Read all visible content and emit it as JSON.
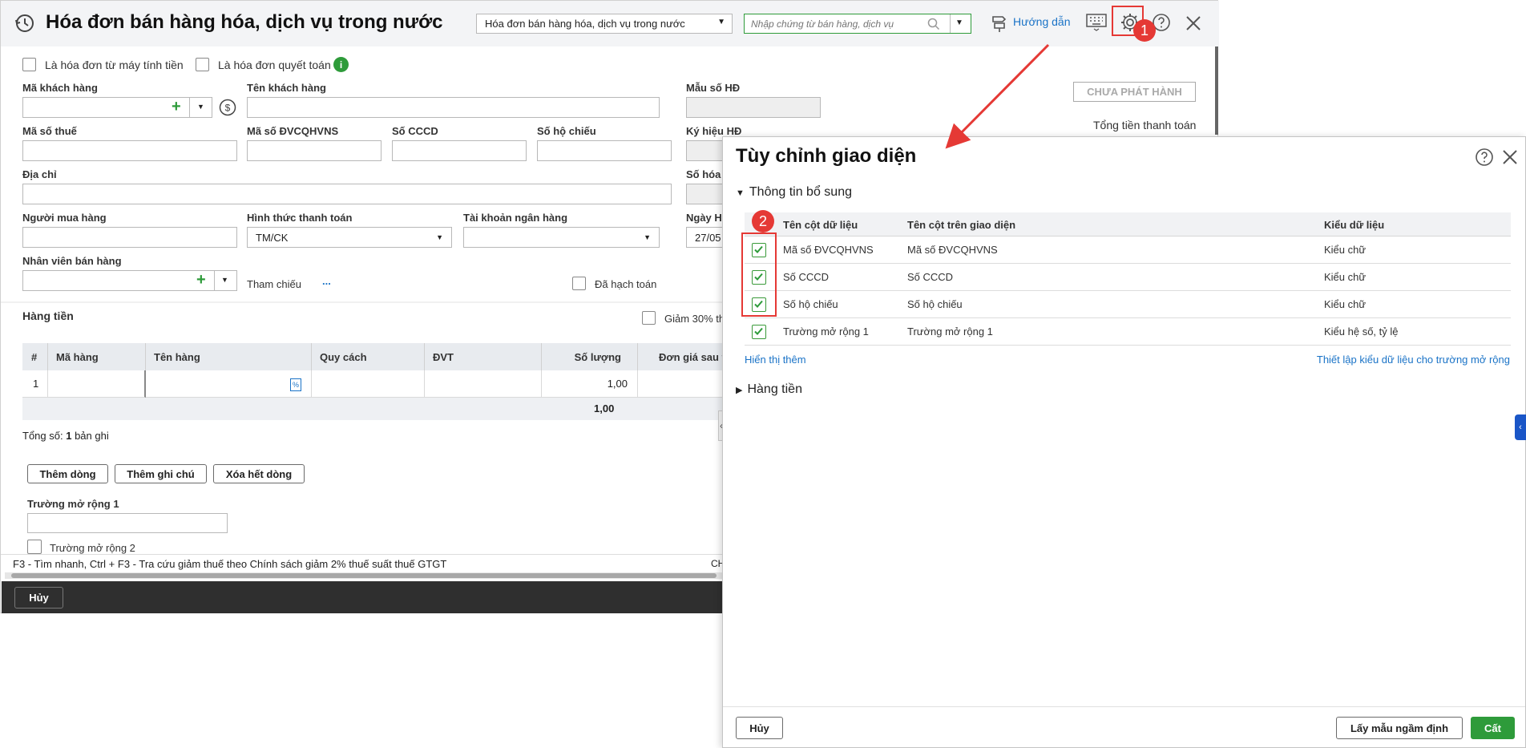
{
  "header": {
    "title": "Hóa đơn bán hàng hóa, dịch vụ trong nước",
    "type_select": "Hóa đơn bán hàng hóa, dịch vụ trong nước",
    "search_placeholder": "Nhập chứng từ bán hàng, dịch vụ",
    "guide": "Hướng dẫn"
  },
  "form": {
    "cb_cash_register": "Là hóa đơn từ máy tính tiền",
    "cb_settlement": "Là hóa đơn quyết toán",
    "customer_code": "Mã khách hàng",
    "customer_name": "Tên khách hàng",
    "tax_code": "Mã số thuế",
    "budget_unit_code": "Mã số ĐVCQHVNS",
    "citizen_id": "Số CCCD",
    "passport": "Số hộ chiếu",
    "address": "Địa chỉ",
    "buyer": "Người mua hàng",
    "payment_method": "Hình thức thanh toán",
    "payment_method_value": "TM/CK",
    "bank_account": "Tài khoản ngân hàng",
    "sales_staff": "Nhân viên bán hàng",
    "reference": "Tham chiếu",
    "reference_dots": "...",
    "posted": "Đã hạch toán",
    "invoice_form": "Mẫu số HĐ",
    "invoice_symbol": "Ký hiệu HĐ",
    "invoice_number_partial": "Số hóa đ",
    "date_partial": "Ngày H",
    "date_value_partial": "27/05",
    "status_button": "CHƯA PHÁT HÀNH",
    "total_payment": "Tổng tiền thanh toán"
  },
  "goods": {
    "section": "Hàng tiền",
    "discount_partial": "Giảm 30% th",
    "columns": [
      "#",
      "Mã hàng",
      "Tên hàng",
      "Quy cách",
      "ĐVT",
      "Số lượng",
      "Đơn giá sau t"
    ],
    "row_index": "1",
    "row_quantity": "1,00",
    "total_quantity": "1,00",
    "total_label": "Tổng số:",
    "total_count": "1",
    "total_unit": "bản ghi",
    "btn_add_row": "Thêm dòng",
    "btn_add_note": "Thêm ghi chú",
    "btn_delete_all": "Xóa hết dòng",
    "ext_field_1": "Trường mở rộng 1",
    "ext_field_2": "Trường mở rộng 2"
  },
  "status_bar": {
    "hint": "F3 - Tìm nhanh, Ctrl + F3 - Tra cứu giảm thuế theo Chính sách giảm 2% thuế suất thuế GTGT",
    "right_partial": "CH"
  },
  "footer": {
    "cancel": "Hủy"
  },
  "panel": {
    "title": "Tùy chỉnh giao diện",
    "section_additional": "Thông tin bổ sung",
    "col_data_name": "Tên cột dữ liệu",
    "col_display_name": "Tên cột trên giao diện",
    "col_data_type": "Kiểu dữ liệu",
    "rows": [
      {
        "name": "Mã số ĐVCQHVNS",
        "display": "Mã số ĐVCQHVNS",
        "type": "Kiểu chữ",
        "checked": true
      },
      {
        "name": "Số CCCD",
        "display": "Số CCCD",
        "type": "Kiểu chữ",
        "checked": true
      },
      {
        "name": "Số hộ chiếu",
        "display": "Số hộ chiếu",
        "type": "Kiểu chữ",
        "checked": true
      },
      {
        "name": "Trường mở rộng 1",
        "display": "Trường mở rộng 1",
        "type": "Kiểu hệ số, tỷ lệ",
        "checked": true
      }
    ],
    "show_more": "Hiển thị thêm",
    "setup_ext_types": "Thiết lập kiểu dữ liệu cho trường mở rộng",
    "section_goods": "Hàng tiền",
    "cancel": "Hủy",
    "default": "Lấy mẫu ngầm định",
    "save": "Cất"
  },
  "annotations": {
    "badge1": "1",
    "badge2": "2"
  },
  "colors": {
    "accent_green": "#2e9b3a",
    "link_blue": "#1a73c7",
    "annotation_red": "#e53935",
    "footer_dark": "#2f2f2f"
  }
}
